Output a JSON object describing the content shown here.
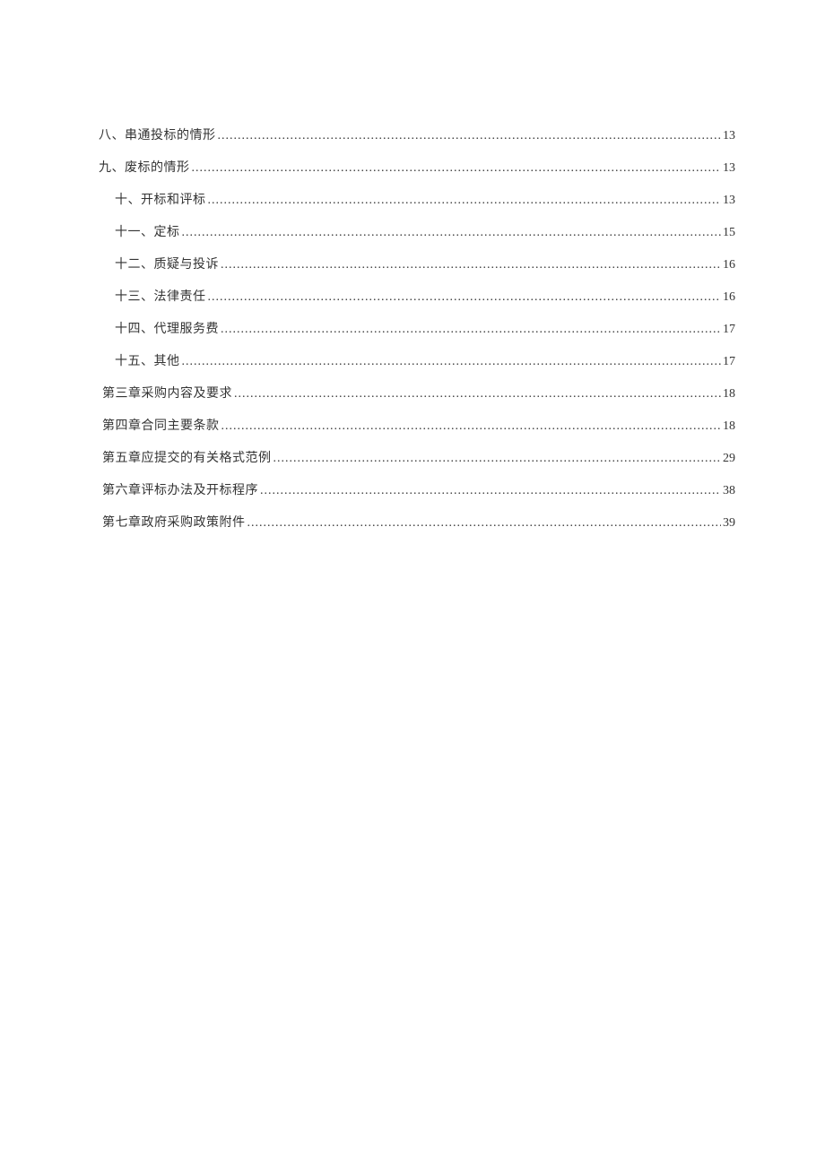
{
  "toc": {
    "entries": [
      {
        "title": "八、串通投标的情形",
        "page": "13",
        "indent": 1
      },
      {
        "title": "九、废标的情形",
        "page": "13",
        "indent": 1
      },
      {
        "title": "十、开标和评标",
        "page": "13",
        "indent": 2
      },
      {
        "title": "十一、定标",
        "page": "15",
        "indent": 2
      },
      {
        "title": "十二、质疑与投诉",
        "page": "16",
        "indent": 2
      },
      {
        "title": "十三、法律责任",
        "page": "16",
        "indent": 2
      },
      {
        "title": "十四、代理服务费",
        "page": "17",
        "indent": 2
      },
      {
        "title": "十五、其他",
        "page": "17",
        "indent": 2
      },
      {
        "title": "第三章采购内容及要求",
        "page": "18",
        "indent": 3
      },
      {
        "title": "第四章合同主要条款",
        "page": "18",
        "indent": 3
      },
      {
        "title": "第五章应提交的有关格式范例",
        "page": "29",
        "indent": 3
      },
      {
        "title": "第六章评标办法及开标程序",
        "page": "38",
        "indent": 3
      },
      {
        "title": "第七章政府采购政策附件",
        "page": "39",
        "indent": 3
      }
    ]
  }
}
